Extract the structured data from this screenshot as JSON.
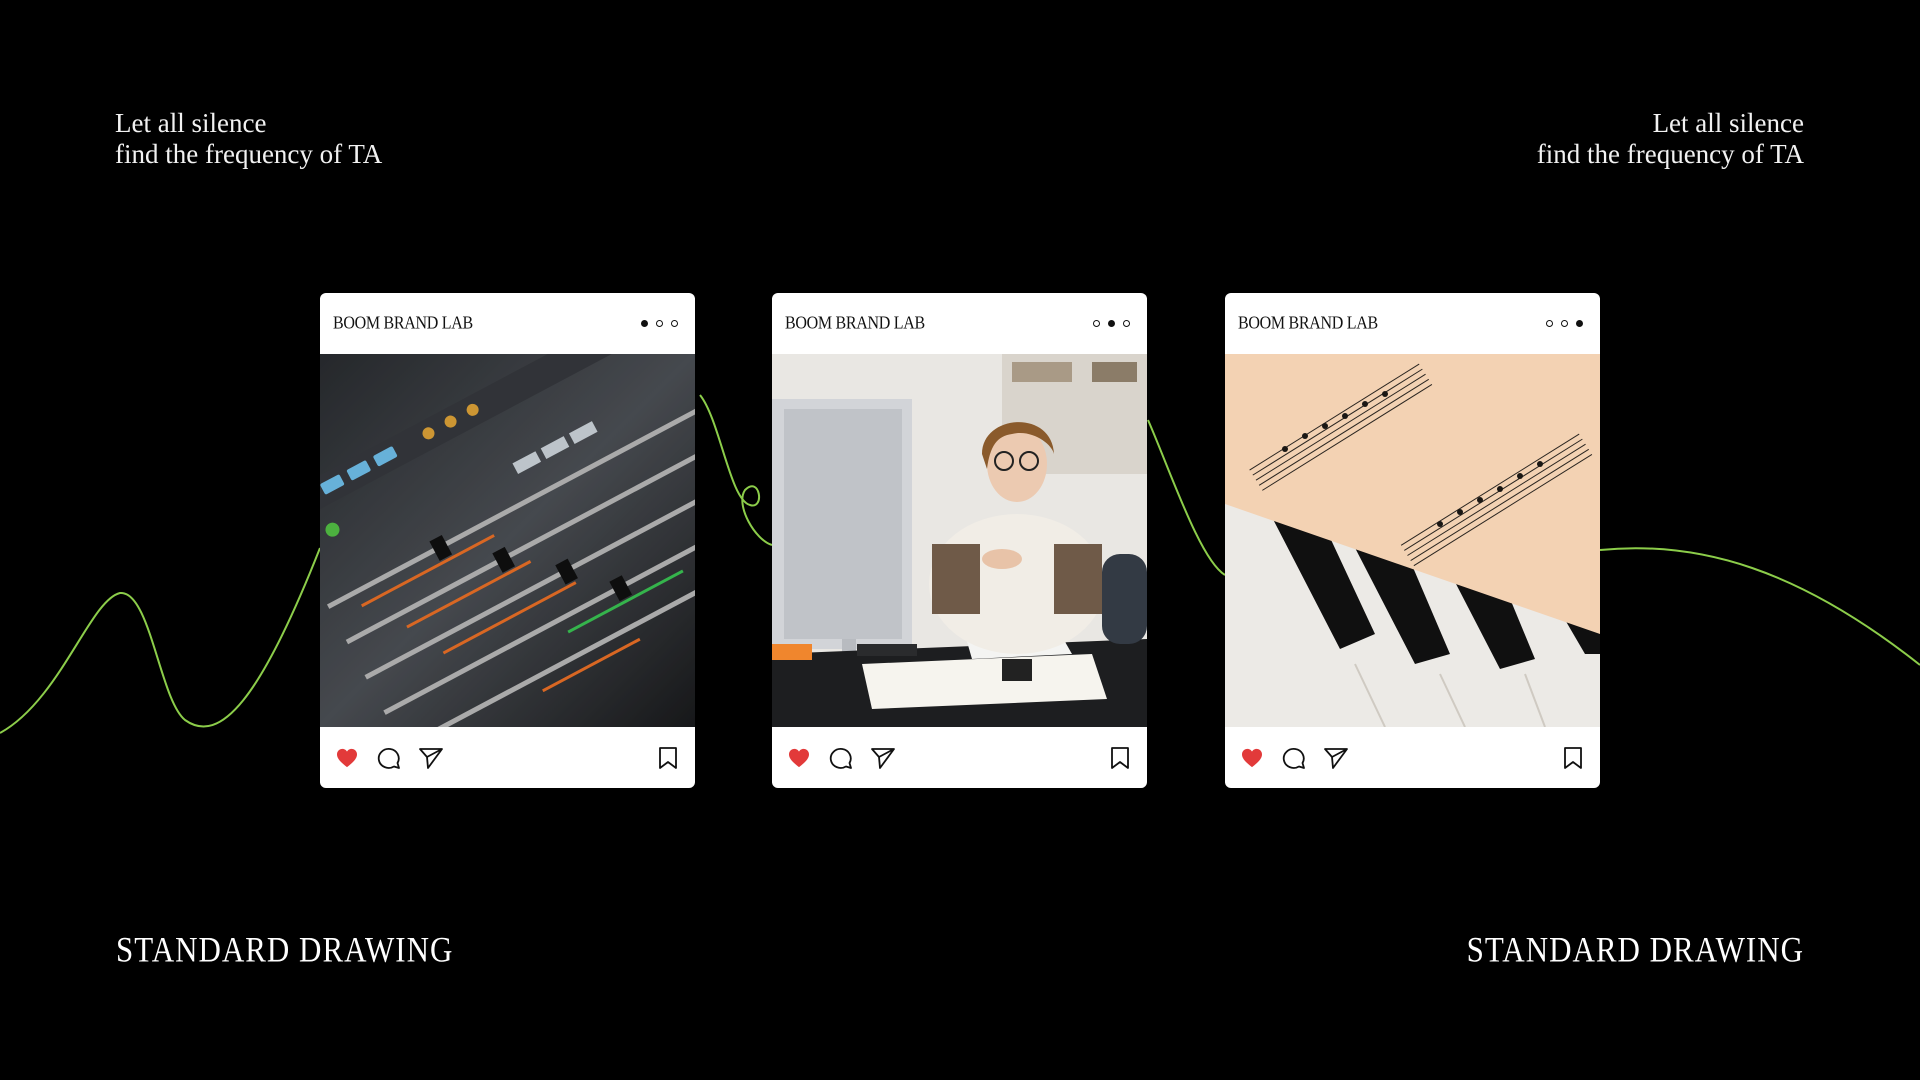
{
  "tagline": {
    "line1": "Let all silence",
    "line2": "find the frequency of TA"
  },
  "footer_mark": "STANDARD DRAWING",
  "accent_color": "#8ccd4a",
  "like_color": "#e23a3a",
  "posts": [
    {
      "brand": "BOOM BRAND LAB",
      "active_dot": 1,
      "image": "audio-mixing-console",
      "icons": [
        "heart-icon",
        "comment-icon",
        "share-icon",
        "bookmark-icon"
      ]
    },
    {
      "brand": "BOOM BRAND LAB",
      "active_dot": 2,
      "image": "woman-at-desk-with-computer",
      "icons": [
        "heart-icon",
        "comment-icon",
        "share-icon",
        "bookmark-icon"
      ]
    },
    {
      "brand": "BOOM BRAND LAB",
      "active_dot": 3,
      "image": "sheet-music-on-piano",
      "icons": [
        "heart-icon",
        "comment-icon",
        "share-icon",
        "bookmark-icon"
      ]
    }
  ]
}
